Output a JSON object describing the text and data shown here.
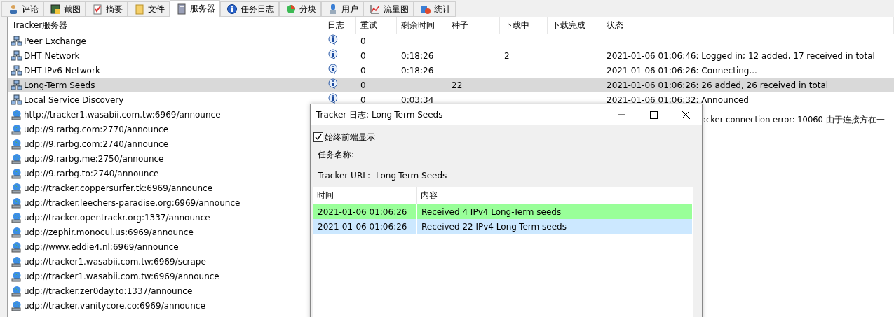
{
  "tabs": [
    {
      "label": "评论",
      "selected": false
    },
    {
      "label": "截图",
      "selected": false
    },
    {
      "label": "摘要",
      "selected": false
    },
    {
      "label": "文件",
      "selected": false
    },
    {
      "label": "服务器",
      "selected": true
    },
    {
      "label": "任务日志",
      "selected": false
    },
    {
      "label": "分块",
      "selected": false
    },
    {
      "label": "用户",
      "selected": false
    },
    {
      "label": "流量图",
      "selected": false
    },
    {
      "label": "统计",
      "selected": false
    }
  ],
  "table": {
    "columns": [
      "Tracker服务器",
      "日志",
      "重试",
      "剩余时间",
      "种子",
      "下载中",
      "下载完成",
      "状态"
    ],
    "rows": [
      {
        "kind": "network",
        "name": "Peer Exchange",
        "retry": "0",
        "selected": false
      },
      {
        "kind": "network",
        "name": "DHT Network",
        "retry": "0",
        "remaining": "0:18:26",
        "downloading": "2",
        "status": "2021-01-06 01:06:46: Logged in; 12 added, 17 received in total",
        "selected": false
      },
      {
        "kind": "network",
        "name": "DHT IPv6 Network",
        "retry": "0",
        "remaining": "0:18:26",
        "status": "2021-01-06 01:06:26: Connecting...",
        "selected": false
      },
      {
        "kind": "network",
        "name": "Long-Term Seeds",
        "retry": "0",
        "seeds": "22",
        "status": "2021-01-06 01:06:26: 26 added, 26 received in total",
        "selected": true
      },
      {
        "kind": "network",
        "name": "Local Service Discovery",
        "retry": "0",
        "remaining": "0:03:34",
        "status": "2021-01-06 01:06:32: Announced",
        "selected": false
      },
      {
        "kind": "globe",
        "name": "http://tracker1.wasabii.com.tw:6969/announce",
        "status_tail": "acker connection error: 10060 由于连接方在一",
        "selected": false
      },
      {
        "kind": "globe",
        "name": "udp://9.rarbg.com:2770/announce",
        "selected": false
      },
      {
        "kind": "globe",
        "name": "udp://9.rarbg.com:2740/announce",
        "selected": false
      },
      {
        "kind": "globe",
        "name": "udp://9.rarbg.me:2750/announce",
        "selected": false
      },
      {
        "kind": "globe",
        "name": "udp://9.rarbg.to:2740/announce",
        "selected": false
      },
      {
        "kind": "globe",
        "name": "udp://tracker.coppersurfer.tk:6969/announce",
        "selected": false
      },
      {
        "kind": "globe",
        "name": "udp://tracker.leechers-paradise.org:6969/announce",
        "selected": false
      },
      {
        "kind": "globe",
        "name": "udp://tracker.opentrackr.org:1337/announce",
        "selected": false
      },
      {
        "kind": "globe",
        "name": "udp://zephir.monocul.us:6969/announce",
        "selected": false
      },
      {
        "kind": "globe",
        "name": "udp://www.eddie4.nl:6969/announce",
        "selected": false
      },
      {
        "kind": "globe",
        "name": "udp://tracker1.wasabii.com.tw:6969/scrape",
        "selected": false
      },
      {
        "kind": "globe",
        "name": "udp://tracker1.wasabii.com.tw:6969/announce",
        "selected": false
      },
      {
        "kind": "globe",
        "name": "udp://tracker.zer0day.to:1337/announce",
        "selected": false
      },
      {
        "kind": "globe",
        "name": "udp://tracker.vanitycore.co:6969/announce",
        "selected": false
      }
    ]
  },
  "dialog": {
    "title": "Tracker 日志: Long-Term Seeds",
    "always_on_top": {
      "label": "始终前端显示",
      "checked": true
    },
    "task_name_label": "任务名称:",
    "tracker_url_label": "Tracker URL:",
    "tracker_url": "Long-Term Seeds",
    "log": {
      "columns": [
        "时间",
        "内容"
      ],
      "rows": [
        {
          "time": "2021-01-06 01:06:26",
          "content": "Received 4 IPv4  Long-Term seeds",
          "color": "#99ff99"
        },
        {
          "time": "2021-01-06 01:06:26",
          "content": "Received 22 IPv4  Long-Term seeds",
          "color": "#cce8ff"
        }
      ]
    }
  }
}
